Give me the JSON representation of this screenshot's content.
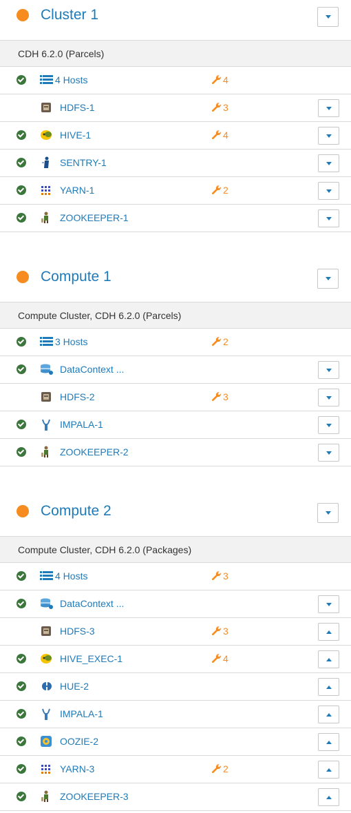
{
  "colors": {
    "link": "#1f7ab8",
    "warning": "#f68c1f",
    "good": "#3c763d",
    "subheader_bg": "#f2f2f2"
  },
  "clusters": [
    {
      "name": "Cluster 1",
      "status": "warning",
      "version": "CDH 6.2.0 (Parcels)",
      "rows": [
        {
          "name": "4 Hosts",
          "status": "good",
          "icon": "hosts-list-icon",
          "issues": "4",
          "menu": null
        },
        {
          "name": "HDFS-1",
          "status": "warning",
          "icon": "hdfs-icon",
          "issues": "3",
          "menu": "down"
        },
        {
          "name": "HIVE-1",
          "status": "good",
          "icon": "hive-icon",
          "issues": "4",
          "menu": "down"
        },
        {
          "name": "SENTRY-1",
          "status": "good",
          "icon": "sentry-icon",
          "issues": "",
          "menu": "down"
        },
        {
          "name": "YARN-1",
          "status": "good",
          "icon": "yarn-icon",
          "issues": "2",
          "menu": "down"
        },
        {
          "name": "ZOOKEEPER-1",
          "status": "good",
          "icon": "zookeeper-icon",
          "issues": "",
          "menu": "down"
        }
      ]
    },
    {
      "name": "Compute 1",
      "status": "warning",
      "version": "Compute Cluster, CDH 6.2.0 (Parcels)",
      "rows": [
        {
          "name": "3 Hosts",
          "status": "good",
          "icon": "hosts-list-icon",
          "issues": "2",
          "menu": null
        },
        {
          "name": "DataContext ...",
          "status": "good",
          "icon": "datacontext-icon",
          "issues": "",
          "menu": "down"
        },
        {
          "name": "HDFS-2",
          "status": "warning",
          "icon": "hdfs-icon",
          "issues": "3",
          "menu": "down"
        },
        {
          "name": "IMPALA-1",
          "status": "good",
          "icon": "impala-icon",
          "issues": "",
          "menu": "down"
        },
        {
          "name": "ZOOKEEPER-2",
          "status": "good",
          "icon": "zookeeper-icon",
          "issues": "",
          "menu": "down"
        }
      ]
    },
    {
      "name": "Compute 2",
      "status": "warning",
      "version": "Compute Cluster, CDH 6.2.0 (Packages)",
      "rows": [
        {
          "name": "4 Hosts",
          "status": "good",
          "icon": "hosts-list-icon",
          "issues": "3",
          "menu": null
        },
        {
          "name": "DataContext ...",
          "status": "good",
          "icon": "datacontext-icon",
          "issues": "",
          "menu": "down"
        },
        {
          "name": "HDFS-3",
          "status": "warning",
          "icon": "hdfs-icon",
          "issues": "3",
          "menu": "up"
        },
        {
          "name": "HIVE_EXEC-1",
          "status": "good",
          "icon": "hive-icon",
          "issues": "4",
          "menu": "up"
        },
        {
          "name": "HUE-2",
          "status": "good",
          "icon": "hue-icon",
          "issues": "",
          "menu": "up"
        },
        {
          "name": "IMPALA-1",
          "status": "good",
          "icon": "impala-icon",
          "issues": "",
          "menu": "up"
        },
        {
          "name": "OOZIE-2",
          "status": "good",
          "icon": "oozie-icon",
          "issues": "",
          "menu": "up"
        },
        {
          "name": "YARN-3",
          "status": "good",
          "icon": "yarn-icon",
          "issues": "2",
          "menu": "up"
        },
        {
          "name": "ZOOKEEPER-3",
          "status": "good",
          "icon": "zookeeper-icon",
          "issues": "",
          "menu": "up"
        }
      ]
    }
  ]
}
